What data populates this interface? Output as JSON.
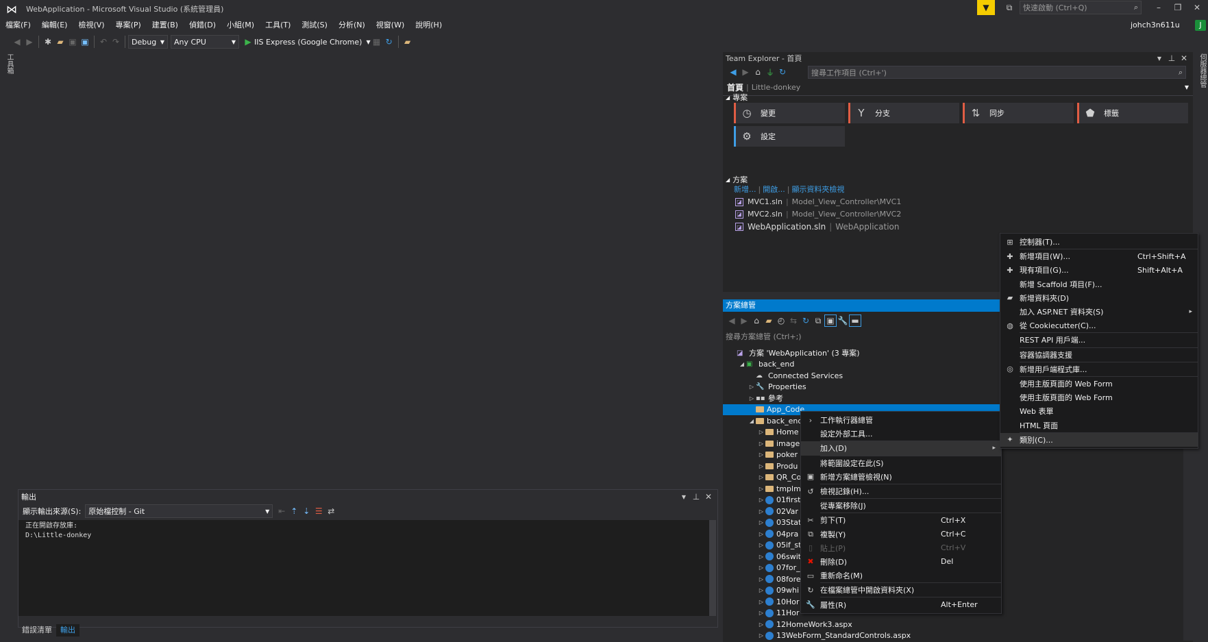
{
  "titlebar": {
    "logo": "visual-studio-logo",
    "title": "WebApplication - Microsoft Visual Studio (系統管理員)",
    "quick_launch_placeholder": "快速啟動 (Ctrl+Q)",
    "user": "johch3n611u",
    "avatar": "J"
  },
  "menu": [
    "檔案(F)",
    "編輯(E)",
    "檢視(V)",
    "專案(P)",
    "建置(B)",
    "偵錯(D)",
    "小組(M)",
    "工具(T)",
    "測試(S)",
    "分析(N)",
    "視窗(W)",
    "說明(H)"
  ],
  "toolbar": {
    "config": "Debug",
    "platform": "Any CPU",
    "run": "IIS Express (Google Chrome)"
  },
  "left_strip": {
    "label": "工具箱"
  },
  "right_strip": {
    "label": "伺服器總管"
  },
  "output": {
    "title": "輸出",
    "source_label": "顯示輸出來源(S):",
    "source_value": "原始檔控制 - Git",
    "lines": [
      "正在開啟存放庫:",
      "D:\\Little-donkey"
    ]
  },
  "bottom_tabs": [
    "錯誤清單",
    "輸出"
  ],
  "team": {
    "title": "Team Explorer - 首頁",
    "search_placeholder": "搜尋工作項目 (Ctrl+')",
    "home": "首頁",
    "repo": "Little-donkey",
    "projects_header": "專案",
    "tiles": [
      "變更",
      "分支",
      "同步",
      "標籤",
      "設定"
    ],
    "solutions_header": "方案",
    "links": [
      "新增...",
      "開啟...",
      "顯示資料夾檢視"
    ],
    "solutions": [
      {
        "name": "MVC1.sln",
        "path": "Model_View_Controller\\MVC1"
      },
      {
        "name": "MVC2.sln",
        "path": "Model_View_Controller\\MVC2"
      },
      {
        "name": "WebApplication.sln",
        "path": "WebApplication"
      }
    ]
  },
  "solution": {
    "title": "方案總管",
    "search_placeholder": "搜尋方案總管 (Ctrl+;)",
    "nodes": [
      {
        "t": "方案 'WebApplication' (3 專案)",
        "d": 0,
        "tri": "",
        "k": "sln"
      },
      {
        "t": "back_end",
        "d": 1,
        "tri": "◢",
        "k": "proj"
      },
      {
        "t": "Connected Services",
        "d": 2,
        "tri": "",
        "k": "cloud"
      },
      {
        "t": "Properties",
        "d": 2,
        "tri": "▷",
        "k": "wrench"
      },
      {
        "t": "參考",
        "d": 2,
        "tri": "▷",
        "k": "ref"
      },
      {
        "t": "App_Code",
        "d": 2,
        "tri": "",
        "k": "folder",
        "sel": true
      },
      {
        "t": "back_end",
        "d": 2,
        "tri": "◢",
        "k": "folder"
      },
      {
        "t": "Home",
        "d": 3,
        "tri": "▷",
        "k": "folder"
      },
      {
        "t": "image",
        "d": 3,
        "tri": "▷",
        "k": "folder"
      },
      {
        "t": "poker",
        "d": 3,
        "tri": "▷",
        "k": "folder"
      },
      {
        "t": "Produ",
        "d": 3,
        "tri": "▷",
        "k": "folder"
      },
      {
        "t": "QR_Co",
        "d": 3,
        "tri": "▷",
        "k": "folder"
      },
      {
        "t": "tmplm",
        "d": 3,
        "tri": "▷",
        "k": "folder"
      },
      {
        "t": "01first",
        "d": 3,
        "tri": "▷",
        "k": "file"
      },
      {
        "t": "02Var",
        "d": 3,
        "tri": "▷",
        "k": "file"
      },
      {
        "t": "03Stat",
        "d": 3,
        "tri": "▷",
        "k": "file"
      },
      {
        "t": "04pra",
        "d": 3,
        "tri": "▷",
        "k": "file"
      },
      {
        "t": "05if_st",
        "d": 3,
        "tri": "▷",
        "k": "file"
      },
      {
        "t": "06swit",
        "d": 3,
        "tri": "▷",
        "k": "file"
      },
      {
        "t": "07for_",
        "d": 3,
        "tri": "▷",
        "k": "file"
      },
      {
        "t": "08fore",
        "d": 3,
        "tri": "▷",
        "k": "file"
      },
      {
        "t": "09whi",
        "d": 3,
        "tri": "▷",
        "k": "file"
      },
      {
        "t": "10Hor",
        "d": 3,
        "tri": "▷",
        "k": "file"
      },
      {
        "t": "11Hor",
        "d": 3,
        "tri": "▷",
        "k": "file"
      },
      {
        "t": "12HomeWork3.aspx",
        "d": 3,
        "tri": "▷",
        "k": "file"
      },
      {
        "t": "13WebForm_StandardControls.aspx",
        "d": 3,
        "tri": "▷",
        "k": "file"
      }
    ]
  },
  "context_menu": [
    {
      "icon": "›",
      "label": "工作執行器總管",
      "sc": ""
    },
    {
      "icon": "",
      "label": "設定外部工具...",
      "sc": ""
    },
    {
      "sep": true
    },
    {
      "icon": "",
      "label": "加入(D)",
      "sc": "",
      "sub": true,
      "hl": true
    },
    {
      "sep": true
    },
    {
      "icon": "",
      "label": "將範圍設定在此(S)",
      "sc": ""
    },
    {
      "icon": "▣",
      "label": "新增方案總管檢視(N)",
      "sc": ""
    },
    {
      "sep": true
    },
    {
      "icon": "↺",
      "label": "檢視記錄(H)...",
      "sc": ""
    },
    {
      "sep": true
    },
    {
      "icon": "",
      "label": "從專案移除(J)",
      "sc": ""
    },
    {
      "sep": true
    },
    {
      "icon": "✂",
      "label": "剪下(T)",
      "sc": "Ctrl+X"
    },
    {
      "icon": "⧉",
      "label": "複製(Y)",
      "sc": "Ctrl+C"
    },
    {
      "icon": "▯",
      "label": "貼上(P)",
      "sc": "Ctrl+V",
      "dis": true
    },
    {
      "icon": "✖",
      "label": "刪除(D)",
      "sc": "Del",
      "red": true
    },
    {
      "icon": "▭",
      "label": "重新命名(M)",
      "sc": ""
    },
    {
      "sep": true
    },
    {
      "icon": "↻",
      "label": "在檔案總管中開啟資料夾(X)",
      "sc": ""
    },
    {
      "sep": true
    },
    {
      "icon": "🔧",
      "label": "屬性(R)",
      "sc": "Alt+Enter"
    }
  ],
  "add_menu": [
    {
      "icon": "⊞",
      "label": "控制器(T)...",
      "sc": ""
    },
    {
      "sep": true
    },
    {
      "icon": "✚",
      "label": "新增項目(W)...",
      "sc": "Ctrl+Shift+A"
    },
    {
      "icon": "✚",
      "label": "現有項目(G)...",
      "sc": "Shift+Alt+A"
    },
    {
      "icon": "",
      "label": "新增 Scaffold 項目(F)...",
      "sc": ""
    },
    {
      "icon": "▰",
      "label": "新增資料夾(D)",
      "sc": ""
    },
    {
      "icon": "",
      "label": "加入 ASP.NET 資料夾(S)",
      "sc": "",
      "sub": true
    },
    {
      "icon": "◍",
      "label": "從 Cookiecutter(C)...",
      "sc": ""
    },
    {
      "sep": true
    },
    {
      "icon": "",
      "label": "REST API 用戶端...",
      "sc": ""
    },
    {
      "sep": true
    },
    {
      "icon": "",
      "label": "容器協調器支援",
      "sc": ""
    },
    {
      "sep": true
    },
    {
      "icon": "◎",
      "label": "新增用戶端程式庫...",
      "sc": ""
    },
    {
      "sep": true
    },
    {
      "icon": "",
      "label": "使用主版頁面的 Web Form",
      "sc": ""
    },
    {
      "icon": "",
      "label": "使用主版頁面的 Web Form",
      "sc": ""
    },
    {
      "icon": "",
      "label": "Web 表單",
      "sc": ""
    },
    {
      "icon": "",
      "label": "HTML 頁面",
      "sc": ""
    },
    {
      "sep": true
    },
    {
      "icon": "✦",
      "label": "類別(C)...",
      "sc": "",
      "hl": true
    }
  ],
  "colors": {
    "accent": "#007acc",
    "link": "#3e9ee6",
    "filter_badge": "#f5cc00"
  }
}
